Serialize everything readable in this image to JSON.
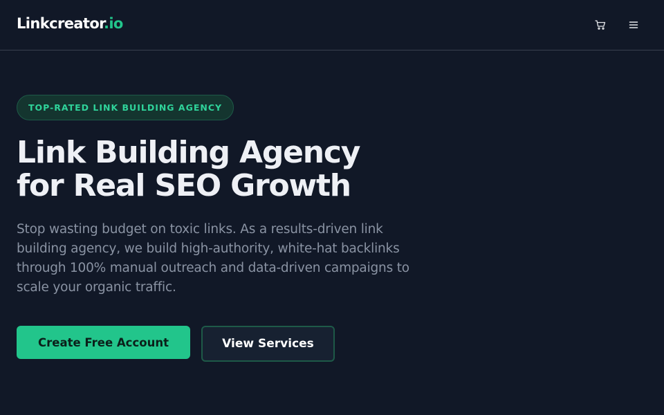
{
  "header": {
    "logo_main": "Linkcreator",
    "logo_accent": ".io",
    "cart_icon": "cart-icon",
    "menu_icon": "menu-icon"
  },
  "hero": {
    "badge": "TOP-RATED LINK BUILDING AGENCY",
    "title_line1": "Link Building Agency",
    "title_line2": "for Real SEO Growth",
    "description": "Stop wasting budget on toxic links. As a results-driven link building agency, we build high-authority, white-hat backlinks through 100% manual outreach and data-driven campaigns to scale your organic traffic.",
    "primary_button": "Create Free Account",
    "secondary_button": "View Services"
  },
  "colors": {
    "background": "#111827",
    "accent": "#22c58b",
    "badge_text": "#2fd39a",
    "muted_text": "#8a93a3"
  }
}
